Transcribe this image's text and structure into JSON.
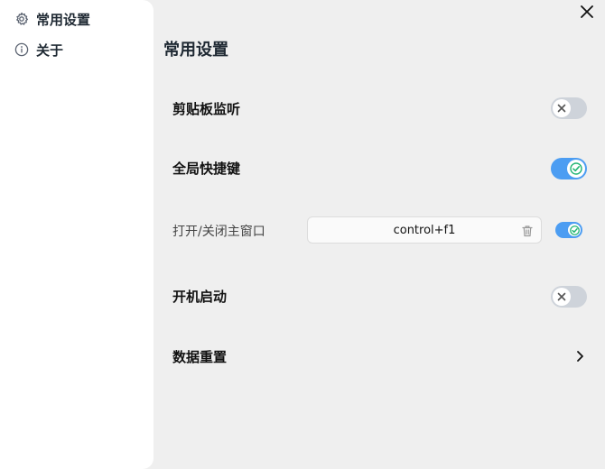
{
  "sidebar": {
    "items": [
      {
        "label": "常用设置",
        "icon": "gear-icon"
      },
      {
        "label": "关于",
        "icon": "info-icon"
      }
    ]
  },
  "main": {
    "title": "常用设置",
    "rows": {
      "clipboard": {
        "label": "剪贴板监听",
        "enabled": false
      },
      "global_shortcut": {
        "label": "全局快捷键",
        "enabled": true
      },
      "toggle_window": {
        "label": "打开/关闭主窗口",
        "shortcut": "control+f1",
        "enabled": true
      },
      "autostart": {
        "label": "开机启动",
        "enabled": false
      },
      "reset": {
        "label": "数据重置"
      }
    }
  },
  "colors": {
    "toggle_on": "#4c9df2",
    "toggle_off": "#ced3da",
    "check_green": "#22b573"
  }
}
